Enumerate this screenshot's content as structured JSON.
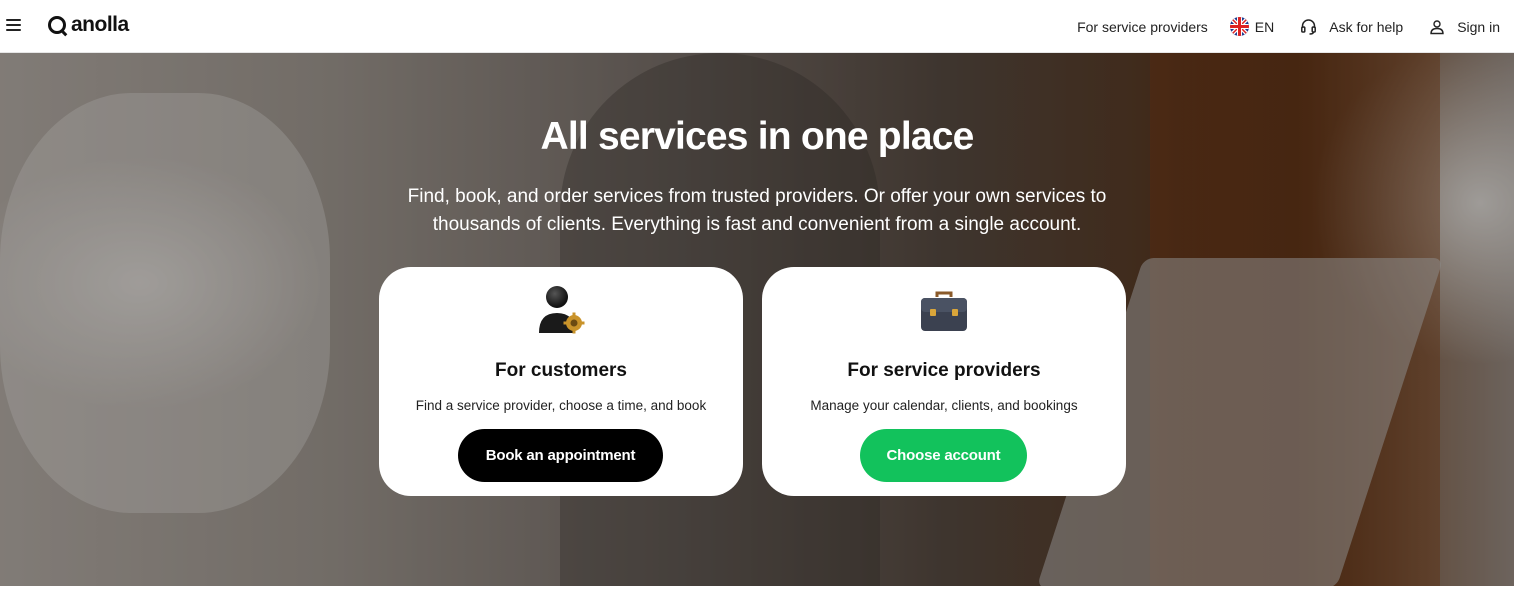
{
  "header": {
    "logo_text": "anolla",
    "nav": {
      "providers_label": "For service providers",
      "language_label": "EN",
      "help_label": "Ask for help",
      "signin_label": "Sign in"
    }
  },
  "hero": {
    "title": "All services in one place",
    "subtitle": "Find, book, and order services from trusted providers. Or offer your own services to thousands of clients. Everything is fast and convenient from a single account."
  },
  "cards": {
    "customers": {
      "icon": "user-gear-icon",
      "title": "For customers",
      "description": "Find a service provider, choose a time, and book",
      "button_label": "Book an appointment"
    },
    "providers": {
      "icon": "briefcase-icon",
      "title": "For service providers",
      "description": "Manage your calendar, clients, and bookings",
      "button_label": "Choose account"
    }
  },
  "colors": {
    "primary_button": "#000000",
    "accent_green": "#12c25c",
    "header_bg": "#ffffff",
    "card_bg": "#ffffff"
  }
}
